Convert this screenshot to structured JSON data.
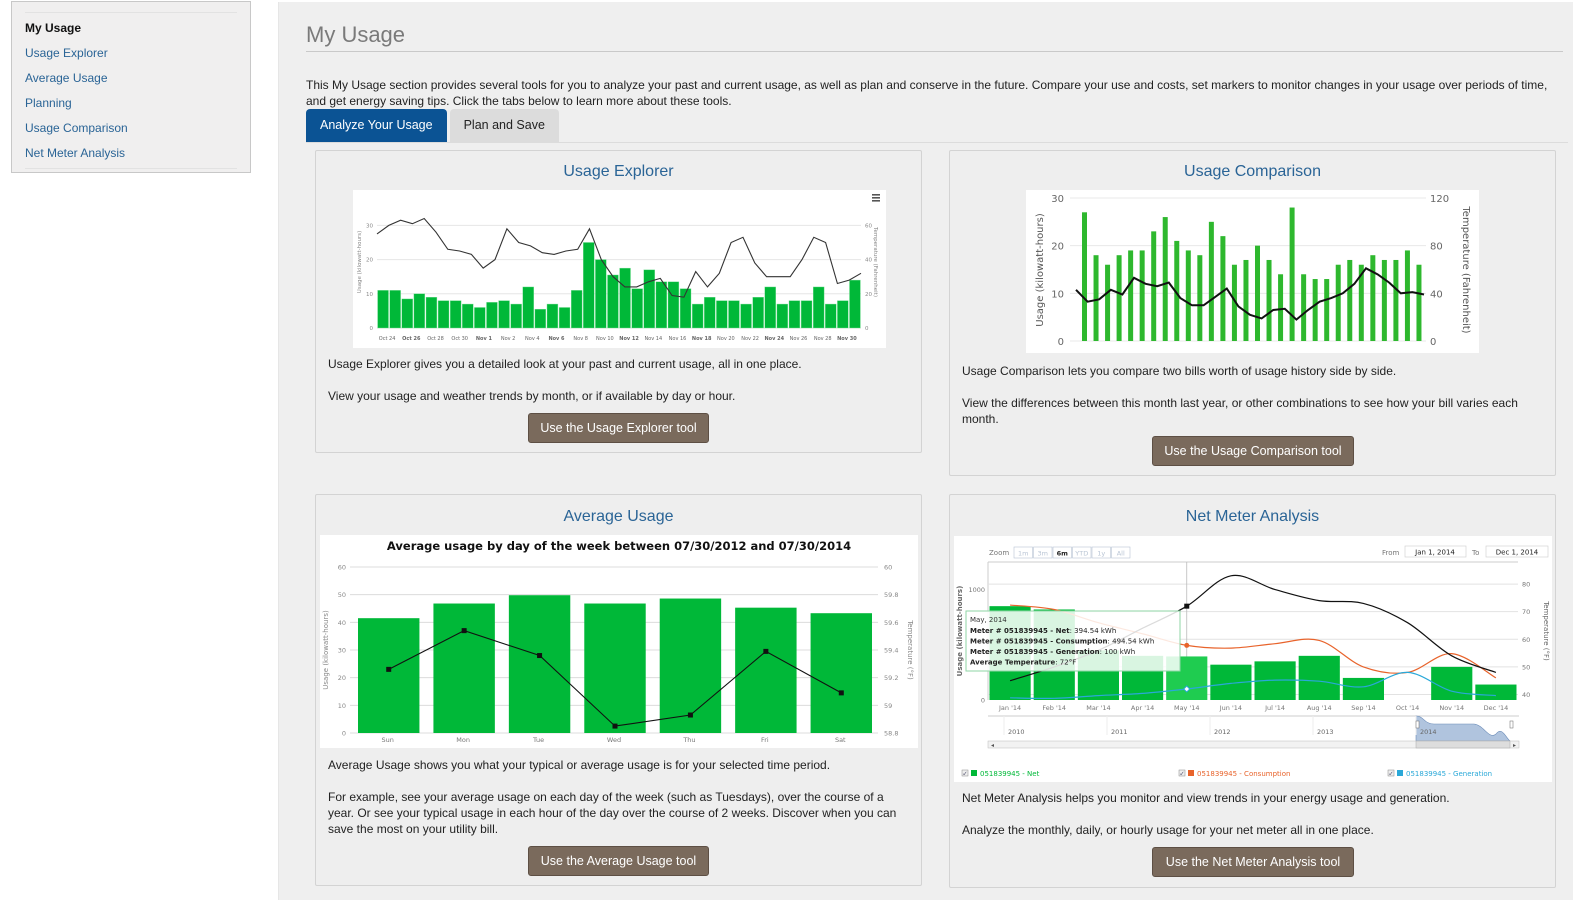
{
  "sidebar": {
    "items": [
      {
        "label": "My Usage",
        "active": true
      },
      {
        "label": "Usage Explorer",
        "active": false
      },
      {
        "label": "Average Usage",
        "active": false
      },
      {
        "label": "Planning",
        "active": false
      },
      {
        "label": "Usage Comparison",
        "active": false
      },
      {
        "label": "Net Meter Analysis",
        "active": false
      }
    ]
  },
  "header": {
    "title": "My Usage",
    "intro": "This My Usage section provides several tools for you to analyze your past and current usage, as well as plan and conserve in the future. Compare your use and costs, set markers to monitor changes in your usage over periods of time, and get energy saving tips. Click the tabs below to learn more about these tools."
  },
  "tabs": [
    {
      "label": "Analyze Your Usage",
      "active": true
    },
    {
      "label": "Plan and Save",
      "active": false
    }
  ],
  "colors": {
    "accent_blue": "#0b5394",
    "link_blue": "#2a6496",
    "button_brown": "#7a6a5c",
    "bar_green": "#00b838",
    "comparison_green": "#2eb82e",
    "consumption_orange": "#e8632b",
    "generation_blue": "#2aa8d8"
  },
  "cards": {
    "usage_explorer": {
      "title": "Usage Explorer",
      "text1": "Usage Explorer gives you a detailed look at your past and current usage, all in one place.",
      "text2": "View your usage and weather trends by month, or if available by day or hour.",
      "button": "Use the Usage Explorer tool",
      "menu_icon": "hamburger-menu-icon"
    },
    "usage_comparison": {
      "title": "Usage Comparison",
      "text1": "Usage Comparison lets you compare two bills worth of usage history side by side.",
      "text2": "View the differences between this month last year, or other combinations to see how your bill varies each month.",
      "button": "Use the Usage Comparison tool"
    },
    "average_usage": {
      "title": "Average Usage",
      "text1": "Average Usage shows you what your typical or average usage is for your selected time period.",
      "text2": "For example, see your average usage on each day of the week (such as Tuesdays), over the course of a year. Or see your typical usage in each hour of the day over the course of 2 weeks. Discover when you can save the most on your utility bill.",
      "button": "Use the Average Usage tool"
    },
    "net_meter": {
      "title": "Net Meter Analysis",
      "text1": "Net Meter Analysis helps you monitor and view trends in your energy usage and generation.",
      "text2": "Analyze the monthly, daily, or hourly usage for your net meter all in one place.",
      "button": "Use the Net Meter Analysis tool",
      "zoom_label": "Zoom",
      "zoom_options": [
        "1m",
        "3m",
        "6m",
        "YTD",
        "1y",
        "All"
      ],
      "zoom_selected": "6m",
      "from_label": "From",
      "from_value": "Jan 1, 2014",
      "to_label": "To",
      "to_value": "Dec 1, 2014",
      "navigator_years": [
        "2010",
        "2011",
        "2012",
        "2013",
        "2014"
      ],
      "tooltip": {
        "title": "May, 2014",
        "lines": [
          {
            "label": "Meter # 051839945 - Net",
            "value": "394.54 kWh"
          },
          {
            "label": "Meter # 051839945 - Consumption",
            "value": "494.54 kWh"
          },
          {
            "label": "Meter # 051839945 - Generation",
            "value": "100 kWh"
          },
          {
            "label": "Average Temperature",
            "value": "72°F"
          }
        ]
      },
      "legend": [
        {
          "label": "051839945 - Net",
          "color": "#00b838",
          "checked": true
        },
        {
          "label": "051839945 - Consumption",
          "color": "#e8632b",
          "checked": true
        },
        {
          "label": "051839945 - Generation",
          "color": "#2aa8d8",
          "checked": true
        }
      ]
    }
  },
  "chart_data": [
    {
      "id": "usage_explorer",
      "type": "bar",
      "title": "",
      "xlabel": "",
      "ylabel": "Usage (kilowatt-hours)",
      "y2label": "Temperature (Fahrenheit)",
      "ylim": [
        0,
        38
      ],
      "y2lim": [
        0,
        76
      ],
      "yticks": [
        0,
        10,
        20,
        30
      ],
      "y2ticks": [
        0,
        20,
        40,
        60
      ],
      "tick_labels": [
        "Oct 24",
        "Oct 26",
        "Oct 28",
        "Oct 30",
        "Nov 1",
        "Nov 2",
        "Nov 4",
        "Nov 6",
        "Nov 8",
        "Nov 10",
        "Nov 12",
        "Nov 14",
        "Nov 16",
        "Nov 18",
        "Nov 20",
        "Nov 22",
        "Nov 24",
        "Nov 26",
        "Nov 28",
        "Nov 30"
      ],
      "series": [
        {
          "name": "Usage",
          "kind": "bar",
          "values": [
            11,
            11,
            8.5,
            10,
            9,
            8,
            8,
            7,
            6,
            7.5,
            8,
            7,
            12,
            5.5,
            7,
            6,
            11,
            25,
            20,
            15.5,
            17.5,
            11.5,
            17,
            13.5,
            13.5,
            11.5,
            7,
            9,
            8,
            8,
            7,
            9,
            12,
            7,
            8,
            8,
            12,
            7,
            8,
            14
          ]
        },
        {
          "name": "Temperature",
          "kind": "line",
          "values": [
            55,
            60,
            63,
            61,
            64,
            56,
            46,
            45,
            43,
            35,
            40,
            58,
            50,
            48,
            44,
            43,
            45,
            46,
            58,
            40,
            30,
            24,
            24,
            27,
            29,
            19,
            18,
            33,
            24,
            32,
            50,
            53,
            38,
            30,
            30,
            30,
            40,
            53,
            50,
            26,
            28,
            32
          ]
        }
      ]
    },
    {
      "id": "usage_comparison",
      "type": "bar",
      "title": "",
      "ylabel": "Usage (kilowatt-hours)",
      "y2label": "Temperature (Fahrenheit)",
      "ylim": [
        0,
        30
      ],
      "y2lim": [
        0,
        120
      ],
      "yticks": [
        0,
        10,
        20,
        30
      ],
      "y2ticks": [
        0,
        40,
        80,
        120
      ],
      "series": [
        {
          "name": "Usage",
          "kind": "bar",
          "values": [
            27,
            18,
            16,
            18,
            19,
            19,
            23,
            26,
            21,
            19,
            18,
            25,
            22,
            16,
            17,
            20,
            17,
            14,
            28,
            14,
            13,
            13,
            16,
            17,
            16,
            18,
            17,
            17,
            19,
            16
          ]
        },
        {
          "name": "Temperature",
          "kind": "line",
          "values": [
            43,
            33,
            35,
            43,
            39,
            53,
            48,
            46,
            49,
            36,
            30,
            30,
            37,
            44,
            29,
            22,
            19,
            26,
            27,
            18,
            26,
            33,
            36,
            40,
            48,
            61,
            56,
            49,
            40,
            41,
            39
          ]
        }
      ]
    },
    {
      "id": "average_usage",
      "type": "bar",
      "title": "Average usage by day of the week between 07/30/2012 and 07/30/2014",
      "xlabel": "",
      "ylabel": "Usage (kilowatt-hours)",
      "y2label": "Temperature (°F)",
      "categories": [
        "Sun",
        "Mon",
        "Tue",
        "Wed",
        "Thu",
        "Fri",
        "Sat"
      ],
      "ylim": [
        0,
        60
      ],
      "y2lim": [
        58.8,
        60
      ],
      "yticks": [
        0,
        10,
        20,
        30,
        40,
        50,
        60
      ],
      "y2ticks": [
        58.8,
        59,
        59.2,
        59.4,
        59.6,
        59.8,
        60
      ],
      "series": [
        {
          "name": "Usage",
          "kind": "bar",
          "values": [
            41.5,
            46.8,
            49.8,
            46.8,
            48.6,
            45.3,
            43.3
          ]
        },
        {
          "name": "Temperature",
          "kind": "line",
          "values": [
            59.26,
            59.54,
            59.36,
            58.85,
            58.93,
            59.39,
            59.09
          ]
        }
      ]
    },
    {
      "id": "net_meter",
      "type": "bar",
      "title": "",
      "ylabel": "Usage (kilowatt-hours)",
      "y2label": "Temperature (°F)",
      "categories": [
        "Jan '14",
        "Feb '14",
        "Mar '14",
        "Apr '14",
        "May '14",
        "Jun '14",
        "Jul '14",
        "Aug '14",
        "Sep '14",
        "Oct '14",
        "Nov '14",
        "Dec '14"
      ],
      "ylim": [
        0,
        1250
      ],
      "y2lim": [
        38,
        88
      ],
      "yticks": [
        0,
        1000
      ],
      "y2ticks": [
        40,
        50,
        60,
        70,
        80
      ],
      "series": [
        {
          "name": "051839945 - Net",
          "kind": "bar",
          "values": [
            850,
            820,
            450,
            400,
            394.54,
            320,
            350,
            400,
            200,
            0,
            300,
            140
          ]
        },
        {
          "name": "051839945 - Consumption",
          "kind": "line",
          "values": [
            860,
            820,
            700,
            600,
            494.54,
            470,
            510,
            540,
            300,
            250,
            420,
            200
          ]
        },
        {
          "name": "051839945 - Generation",
          "kind": "line",
          "values": [
            20,
            15,
            40,
            60,
            100,
            150,
            180,
            170,
            120,
            250,
            80,
            40
          ]
        },
        {
          "name": "Average Temperature",
          "kind": "line",
          "axis": "right",
          "values": [
            45,
            50,
            56,
            64,
            72,
            83,
            78,
            74,
            73,
            66,
            54,
            48
          ]
        }
      ]
    }
  ]
}
